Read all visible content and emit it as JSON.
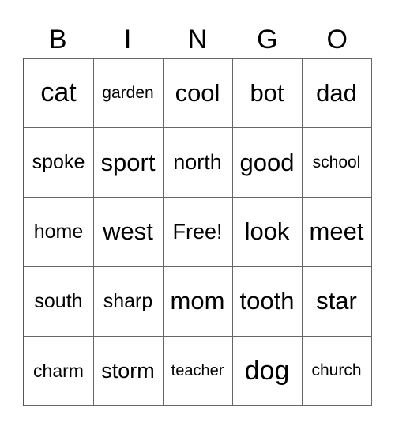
{
  "header": [
    "B",
    "I",
    "N",
    "G",
    "O"
  ],
  "cells": [
    {
      "text": "cat",
      "size": "s36"
    },
    {
      "text": "garden",
      "size": "s22"
    },
    {
      "text": "cool",
      "size": "s32"
    },
    {
      "text": "bot",
      "size": "s32"
    },
    {
      "text": "dad",
      "size": "s32"
    },
    {
      "text": "spoke",
      "size": "s26"
    },
    {
      "text": "sport",
      "size": "s32"
    },
    {
      "text": "north",
      "size": "s28"
    },
    {
      "text": "good",
      "size": "s32"
    },
    {
      "text": "school",
      "size": "s22"
    },
    {
      "text": "home",
      "size": "s26"
    },
    {
      "text": "west",
      "size": "s32"
    },
    {
      "text": "Free!",
      "size": "s28"
    },
    {
      "text": "look",
      "size": "s32"
    },
    {
      "text": "meet",
      "size": "s32"
    },
    {
      "text": "south",
      "size": "s26"
    },
    {
      "text": "sharp",
      "size": "s26"
    },
    {
      "text": "mom",
      "size": "s32"
    },
    {
      "text": "tooth",
      "size": "s32"
    },
    {
      "text": "star",
      "size": "s32"
    },
    {
      "text": "charm",
      "size": "s24"
    },
    {
      "text": "storm",
      "size": "s28"
    },
    {
      "text": "teacher",
      "size": "s20"
    },
    {
      "text": "dog",
      "size": "s36"
    },
    {
      "text": "church",
      "size": "s22"
    }
  ]
}
